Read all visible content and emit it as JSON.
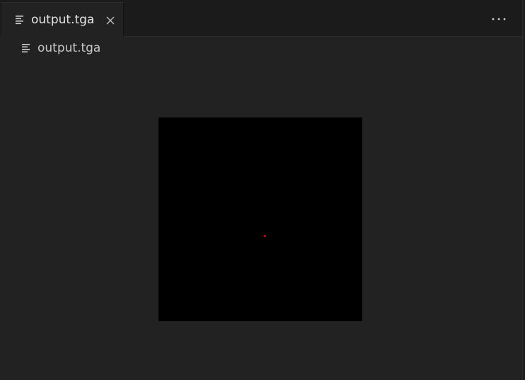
{
  "tab": {
    "label": "output.tga",
    "icon": "file-text-icon",
    "close_icon": "close-icon"
  },
  "toolbar": {
    "more_icon": "ellipsis-icon"
  },
  "breadcrumb": {
    "label": "output.tga",
    "icon": "file-text-icon"
  },
  "preview": {
    "background_color": "#000000",
    "pixel_color": "#cc0000"
  },
  "colors": {
    "editor_background": "#222222",
    "tabbar_background": "#1b1b1b"
  }
}
